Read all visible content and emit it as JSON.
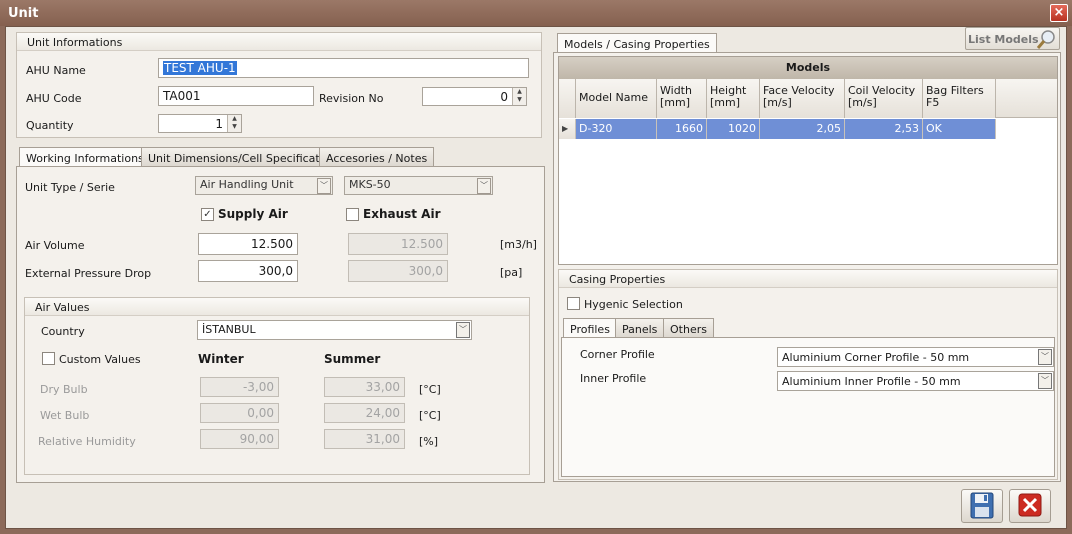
{
  "window": {
    "title": "Unit"
  },
  "unit_info": {
    "header": "Unit Informations",
    "ahu_name_label": "AHU Name",
    "ahu_name_value": "TEST AHU-1",
    "ahu_code_label": "AHU Code",
    "ahu_code_value": "TA001",
    "revision_label": "Revision No",
    "revision_value": "0",
    "quantity_label": "Quantity",
    "quantity_value": "1"
  },
  "left_tabs": [
    "Working Informations",
    "Unit Dimensions/Cell Specifications",
    "Accesories / Notes"
  ],
  "working": {
    "unit_type_label": "Unit Type / Serie",
    "unit_type_value": "Air Handling Unit",
    "serie_value": "MKS-50",
    "supply_air_label": "Supply Air",
    "supply_air_checked": true,
    "exhaust_air_label": "Exhaust Air",
    "exhaust_air_checked": false,
    "air_volume_label": "Air Volume",
    "air_volume_supply": "12.500",
    "air_volume_exhaust": "12.500",
    "air_volume_unit": "[m3/h]",
    "pressure_label": "External Pressure Drop",
    "pressure_supply": "300,0",
    "pressure_exhaust": "300,0",
    "pressure_unit": "[pa]"
  },
  "air_values": {
    "header": "Air Values",
    "country_label": "Country",
    "country_value": "İSTANBUL",
    "custom_values_label": "Custom Values",
    "winter_label": "Winter",
    "summer_label": "Summer",
    "rows": [
      {
        "label": "Dry Bulb",
        "winter": "-3,00",
        "summer": "33,00",
        "unit": "[°C]"
      },
      {
        "label": "Wet Bulb",
        "winter": "0,00",
        "summer": "24,00",
        "unit": "[°C]"
      },
      {
        "label": "Relative Humidity",
        "winter": "90,00",
        "summer": "31,00",
        "unit": "[%]"
      }
    ]
  },
  "right": {
    "tab": "Models / Casing Properties",
    "list_models_label": "List Models",
    "models_title": "Models",
    "columns": [
      "Model Name",
      "Width [mm]",
      "Height [mm]",
      "Face Velocity [m/s]",
      "Coil Velocity [m/s]",
      "Bag Filters F5"
    ],
    "col_lines": [
      [
        "Model Name"
      ],
      [
        "Width",
        "[mm]"
      ],
      [
        "Height",
        "[mm]"
      ],
      [
        "Face Velocity",
        "[m/s]"
      ],
      [
        "Coil Velocity",
        "[m/s]"
      ],
      [
        "Bag Filters",
        "F5"
      ]
    ],
    "rows": [
      {
        "model": "D-320",
        "width": "1660",
        "height": "1020",
        "face": "2,05",
        "coil": "2,53",
        "bag": "OK"
      }
    ],
    "casing_header": "Casing Properties",
    "hygenic_label": "Hygenic Selection",
    "casing_tabs": [
      "Profiles",
      "Panels",
      "Others"
    ],
    "corner_label": "Corner Profile",
    "corner_value": "Aluminium Corner Profile - 50 mm",
    "inner_label": "Inner Profile",
    "inner_value": "Aluminium Inner Profile - 50 mm"
  },
  "colors": {
    "selection": "#3377d8",
    "row_selected": "#6f8fd6",
    "save_icon": "#3f6fb0",
    "cancel_icon": "#cc2b22"
  }
}
